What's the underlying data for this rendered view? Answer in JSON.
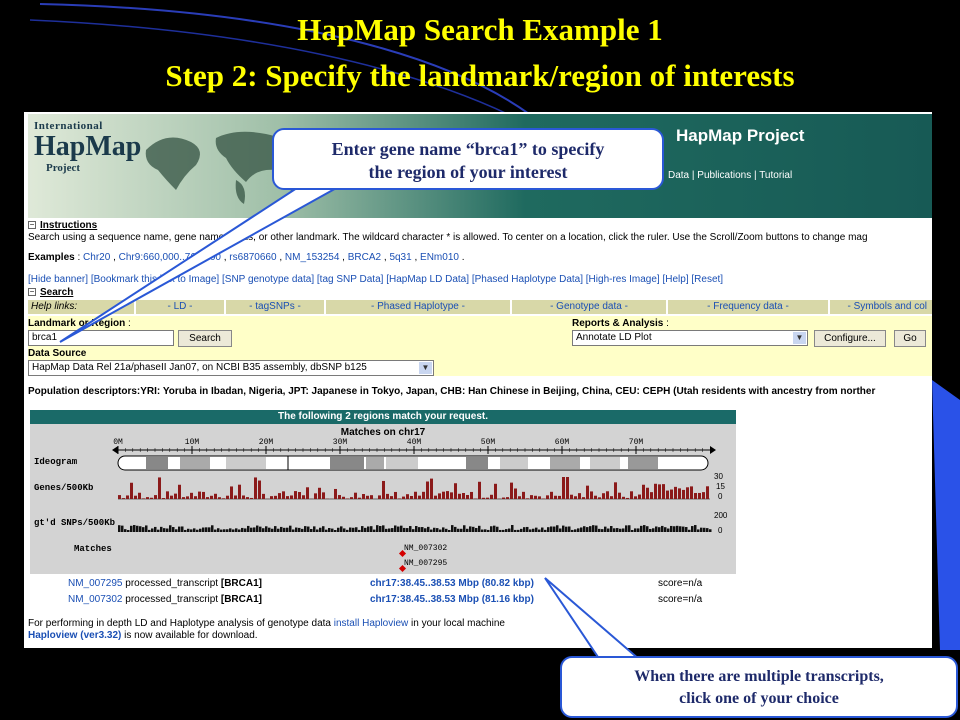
{
  "slide": {
    "title_line1": "HapMap Search Example 1",
    "title_line2": "Step 2: Specify the landmark/region of interests"
  },
  "colors": {
    "title": "#ffff00",
    "callout_border": "#2a58d6",
    "callout_text": "#1e2a6a",
    "link": "#1a4fb4",
    "bar_red": "#8b1a1a",
    "banner_dark": "#175a55"
  },
  "banner": {
    "logo_line1": "International",
    "logo_line2": "HapMap",
    "logo_line3": "Project",
    "project_title": "HapMap Project",
    "links": [
      "Data",
      "Publications",
      "Tutorial"
    ]
  },
  "instructions": {
    "header": "Instructions",
    "text": "Search using a sequence name, gene name, locus, or other landmark. The wildcard character * is allowed. To center on a location, click the ruler. Use the Scroll/Zoom buttons to change mag",
    "examples_label": "Examples",
    "examples": [
      "Chr20",
      "Chr9:660,000..760,000",
      "rs6870660",
      "NM_153254",
      "BRCA2",
      "5q31",
      "ENm010"
    ]
  },
  "toolbar_links": [
    "[Hide banner]",
    "[Bookmark this link to Image]",
    "[SNP genotype data]",
    "[tag SNP Data]",
    "[HapMap LD Data]",
    "[Phased Haplotype Data]",
    "[High-res Image]",
    "[Help]",
    "[Reset]"
  ],
  "search": {
    "header": "Search",
    "help_label": "Help links:",
    "help_links": [
      "- LD -",
      "- tagSNPs -",
      "- Phased Haplotype -",
      "- Genotype data -",
      "- Frequency data -",
      "- Symbols and col"
    ],
    "landmark_label": "Landmark or Region",
    "landmark_value": "brca1",
    "search_button": "Search",
    "reports_label": "Reports & Analysis",
    "reports_value": "Annotate LD Plot",
    "configure_button": "Configure...",
    "go_button": "Go",
    "datasource_label": "Data Source",
    "datasource_value": "HapMap Data Rel 21a/phaseII Jan07, on NCBI B35 assembly, dbSNP b125"
  },
  "population_descriptors": "Population descriptors:YRI: Yoruba in Ibadan, Nigeria, JPT: Japanese in Tokyo, Japan, CHB: Han Chinese in Beijing, China, CEU: CEPH (Utah residents with ancestry from norther",
  "results": {
    "match_bar": "The following 2 regions match your request.",
    "panel_title": "Matches on chr17",
    "ruler_ticks": [
      "0M",
      "10M",
      "20M",
      "30M",
      "40M",
      "50M",
      "60M",
      "70M"
    ],
    "track_ideogram": "Ideogram",
    "track_genes": "Genes/500Kb",
    "track_snps": "gt'd SNPs/500Kb",
    "track_matches": "Matches",
    "genes_scale": [
      "30",
      "15",
      "0"
    ],
    "snps_scale": [
      "200",
      "0"
    ],
    "match_labels": [
      "NM_007302",
      "NM_007295"
    ],
    "rows": [
      {
        "id": "NM_007295",
        "type": "processed_transcript",
        "gene": "[BRCA1]",
        "loc": "chr17:38.45..38.53 Mbp (80.82 kbp)",
        "score": "score=n/a"
      },
      {
        "id": "NM_007302",
        "type": "processed_transcript",
        "gene": "[BRCA1]",
        "loc": "chr17:38.45..38.53 Mbp (81.16 kbp)",
        "score": "score=n/a"
      }
    ],
    "footer_line1_a": "For performing in depth LD and Haplotype analysis of genotype data",
    "footer_line1_link": "install Haploview",
    "footer_line1_b": "in your local machine",
    "footer_line2_link": "Haploview (ver3.32)",
    "footer_line2_b": "is now available for download."
  },
  "callouts": {
    "top_line1": "Enter gene name “brca1” to specify",
    "top_line2": "the region of your interest",
    "bottom_line1": "When there are multiple transcripts,",
    "bottom_line2": "click one of your choice"
  }
}
